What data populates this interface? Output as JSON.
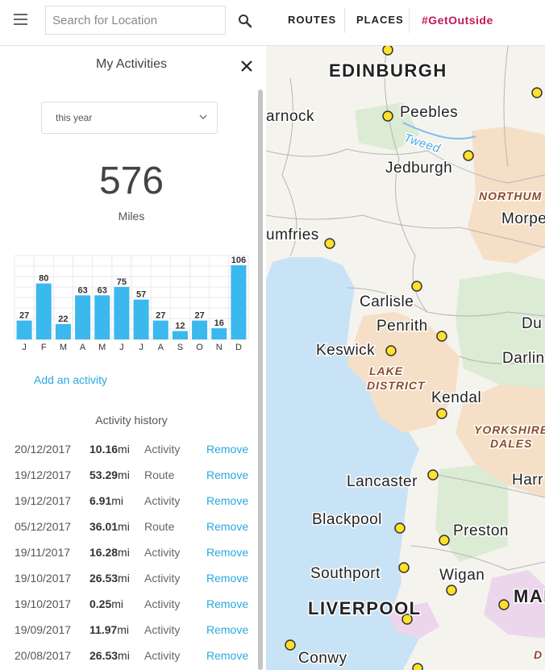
{
  "topbar": {
    "search_placeholder": "Search for Location",
    "nav": {
      "routes": "ROUTES",
      "places": "PLACES",
      "get_outside": "#GetOutside"
    }
  },
  "panel": {
    "title": "My Activities",
    "period": "this year",
    "total_miles": "576",
    "unit": "Miles",
    "add_activity": "Add an activity",
    "history_title": "Activity history",
    "remove_label": "Remove",
    "history": [
      {
        "date": "20/12/2017",
        "distance": "10.16",
        "unit": "mi",
        "type": "Activity"
      },
      {
        "date": "19/12/2017",
        "distance": "53.29",
        "unit": "mi",
        "type": "Route"
      },
      {
        "date": "19/12/2017",
        "distance": "6.91",
        "unit": "mi",
        "type": "Activity"
      },
      {
        "date": "05/12/2017",
        "distance": "36.01",
        "unit": "mi",
        "type": "Route"
      },
      {
        "date": "19/11/2017",
        "distance": "16.28",
        "unit": "mi",
        "type": "Activity"
      },
      {
        "date": "19/10/2017",
        "distance": "26.53",
        "unit": "mi",
        "type": "Activity"
      },
      {
        "date": "19/10/2017",
        "distance": "0.25",
        "unit": "mi",
        "type": "Activity"
      },
      {
        "date": "19/09/2017",
        "distance": "11.97",
        "unit": "mi",
        "type": "Activity"
      },
      {
        "date": "20/08/2017",
        "distance": "26.53",
        "unit": "mi",
        "type": "Activity"
      }
    ]
  },
  "chart_data": {
    "type": "bar",
    "categories": [
      "J",
      "F",
      "M",
      "A",
      "M",
      "J",
      "J",
      "A",
      "S",
      "O",
      "N",
      "D"
    ],
    "values": [
      27,
      80,
      22,
      63,
      63,
      75,
      57,
      27,
      12,
      27,
      16,
      106
    ],
    "ylim": [
      0,
      106
    ],
    "grid": true,
    "bar_color": "#3bb8ee"
  },
  "map": {
    "places": [
      {
        "name": "EDINBURGH",
        "style": "city"
      },
      {
        "name": "Peebles",
        "style": "town"
      },
      {
        "name": "Tweed",
        "style": "river"
      },
      {
        "name": "Jedburgh",
        "style": "town"
      },
      {
        "name": "arnock",
        "style": "town"
      },
      {
        "name": "NORTHUM",
        "style": "region"
      },
      {
        "name": "Morpe",
        "style": "town"
      },
      {
        "name": "umfries",
        "style": "town"
      },
      {
        "name": "Carlisle",
        "style": "town"
      },
      {
        "name": "Penrith",
        "style": "town"
      },
      {
        "name": "Keswick",
        "style": "town"
      },
      {
        "name": "Du",
        "style": "town"
      },
      {
        "name": "Darlin",
        "style": "town"
      },
      {
        "name": "LAKE",
        "style": "region"
      },
      {
        "name": "DISTRICT",
        "style": "region"
      },
      {
        "name": "Kendal",
        "style": "town"
      },
      {
        "name": "YORKSHIRE",
        "style": "region"
      },
      {
        "name": "DALES",
        "style": "region"
      },
      {
        "name": "Lancaster",
        "style": "town"
      },
      {
        "name": "Harr",
        "style": "town"
      },
      {
        "name": "Blackpool",
        "style": "town"
      },
      {
        "name": "Preston",
        "style": "town"
      },
      {
        "name": "Southport",
        "style": "town"
      },
      {
        "name": "Wigan",
        "style": "town"
      },
      {
        "name": "LIVERPOOL",
        "style": "city"
      },
      {
        "name": "MAN",
        "style": "city"
      },
      {
        "name": "Conwy",
        "style": "town"
      },
      {
        "name": "D",
        "style": "region"
      }
    ]
  }
}
